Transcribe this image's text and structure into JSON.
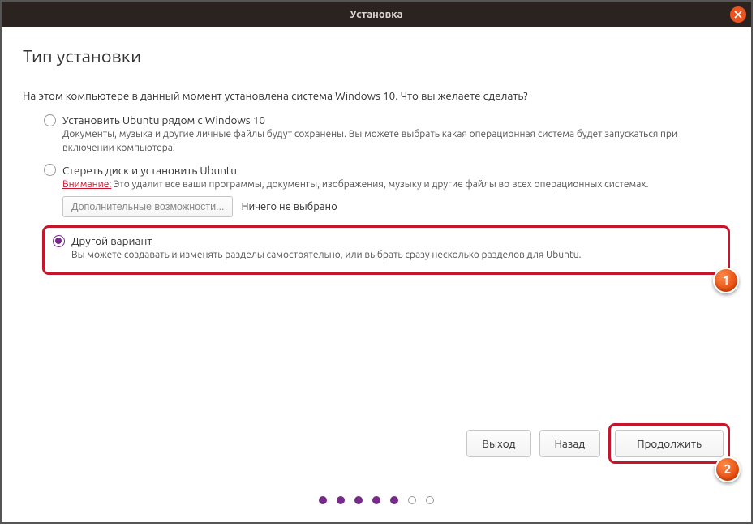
{
  "window": {
    "title": "Установка"
  },
  "page": {
    "heading": "Тип установки",
    "intro": "На этом компьютере в данный момент установлена система Windows 10. Что вы желаете сделать?"
  },
  "options": {
    "alongside": {
      "label": "Установить Ubuntu рядом с Windows 10",
      "desc": "Документы, музыка и другие личные файлы будут сохранены. Вы можете выбрать какая операционная система будет запускаться при включении компьютера."
    },
    "erase": {
      "label": "Стереть диск и установить Ubuntu",
      "warn_prefix": "Внимание:",
      "desc_rest": " Это удалит все ваши программы, документы, изображения, музыку и другие файлы во всех операционных системах.",
      "advanced_btn": "Дополнительные возможности...",
      "advanced_status": "Ничего не выбрано"
    },
    "other": {
      "label": "Другой вариант",
      "desc": "Вы можете создавать и изменять разделы самостоятельно, или выбрать сразу несколько разделов для Ubuntu."
    }
  },
  "buttons": {
    "quit": "Выход",
    "back": "Назад",
    "continue": "Продолжить"
  },
  "callouts": {
    "one": "1",
    "two": "2"
  },
  "progress": {
    "total": 7,
    "current": 5
  },
  "colors": {
    "accent": "#772b88",
    "ubuntu_orange": "#e95420",
    "highlight_red": "#c7162b"
  }
}
